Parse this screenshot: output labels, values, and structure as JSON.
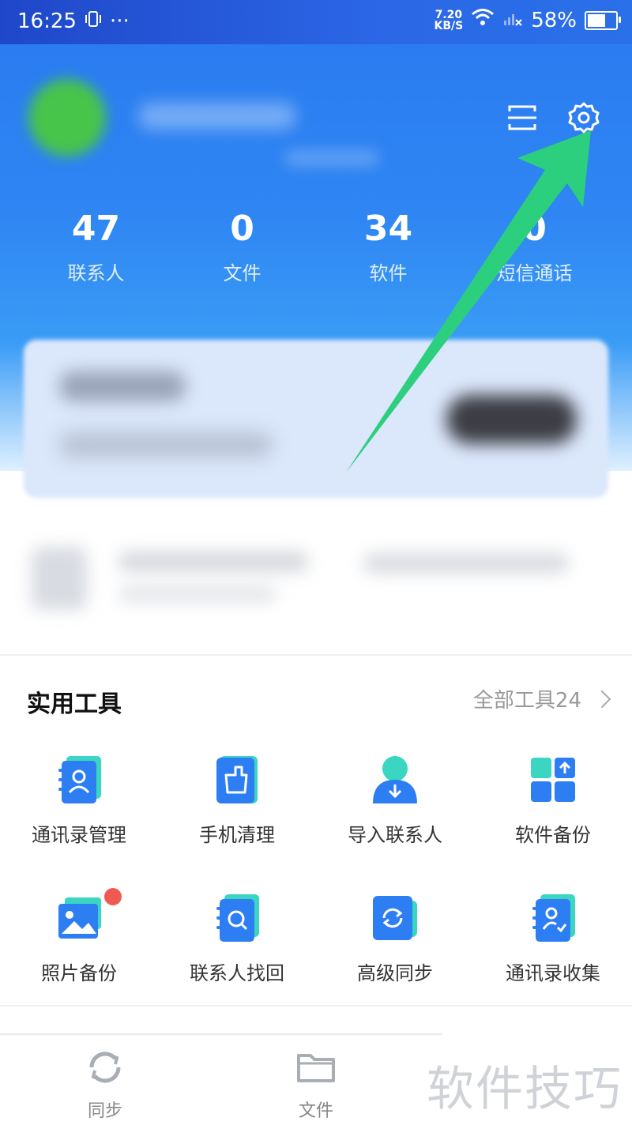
{
  "status_bar": {
    "time": "16:25",
    "more": "···",
    "speed_value": "7.20",
    "speed_unit": "KB/S",
    "battery": "58%"
  },
  "header": {
    "stats": [
      {
        "value": "47",
        "label": "联系人"
      },
      {
        "value": "0",
        "label": "文件"
      },
      {
        "value": "34",
        "label": "软件"
      },
      {
        "value": "0",
        "label": "短信通话"
      }
    ],
    "icons": [
      "scan-icon",
      "settings-icon"
    ]
  },
  "tools": {
    "title": "实用工具",
    "all_label": "全部工具24",
    "items": [
      {
        "label": "通讯录管理",
        "icon": "contact-book-icon"
      },
      {
        "label": "手机清理",
        "icon": "phone-clean-icon"
      },
      {
        "label": "导入联系人",
        "icon": "import-contact-icon"
      },
      {
        "label": "软件备份",
        "icon": "app-backup-icon"
      },
      {
        "label": "照片备份",
        "icon": "photo-backup-icon"
      },
      {
        "label": "联系人找回",
        "icon": "contact-recover-icon"
      },
      {
        "label": "高级同步",
        "icon": "advanced-sync-icon"
      },
      {
        "label": "通讯录收集",
        "icon": "contact-collect-icon"
      }
    ]
  },
  "bottom_nav": {
    "items": [
      {
        "label": "同步",
        "icon": "sync-icon"
      },
      {
        "label": "文件",
        "icon": "folder-icon"
      }
    ]
  },
  "watermark": "软件技巧",
  "colors": {
    "brand_blue": "#2b7cf0",
    "tool_blue": "#2d7ef3",
    "tool_teal": "#3ad6c2",
    "annotation_green": "#2ccf7e",
    "badge_red": "#f05a52"
  }
}
